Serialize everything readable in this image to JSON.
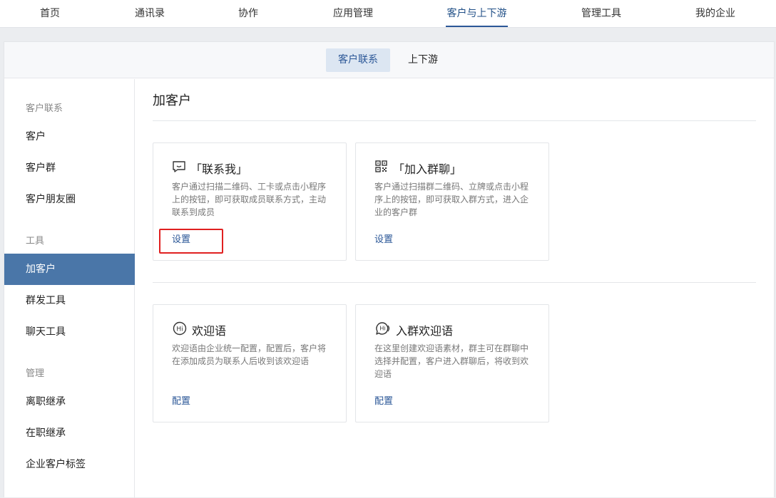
{
  "topnav": {
    "items": [
      "首页",
      "通讯录",
      "协作",
      "应用管理",
      "客户与上下游",
      "管理工具",
      "我的企业"
    ],
    "active_index": 4
  },
  "subtabs": {
    "items": [
      "客户联系",
      "上下游"
    ],
    "active_index": 0
  },
  "sidebar": {
    "group_customer": "客户联系",
    "customer": "客户",
    "customer_group": "客户群",
    "moments": "客户朋友圈",
    "group_tools": "工具",
    "add_customer": "加客户",
    "mass_send": "群发工具",
    "chat_tools": "聊天工具",
    "group_manage": "管理",
    "resign_inherit": "离职继承",
    "onjob_inherit": "在职继承",
    "tags": "企业客户标签"
  },
  "main": {
    "title": "加客户",
    "cards": [
      {
        "title": "「联系我」",
        "desc": "客户通过扫描二维码、工卡或点击小程序上的按钮，即可获取成员联系方式，主动联系到成员",
        "action": "设置",
        "icon": "chat-bubble-icon"
      },
      {
        "title": "「加入群聊」",
        "desc": "客户通过扫描群二维码、立牌或点击小程序上的按钮，即可获取入群方式，进入企业的客户群",
        "action": "设置",
        "icon": "qr-code-icon"
      },
      {
        "title": "欢迎语",
        "desc": "欢迎语由企业统一配置，配置后，客户将在添加成员为联系人后收到该欢迎语",
        "action": "配置",
        "icon": "hi-icon"
      },
      {
        "title": "入群欢迎语",
        "desc": "在这里创建欢迎语素材，群主可在群聊中选择并配置，客户进入群聊后，将收到欢迎语",
        "action": "配置",
        "icon": "hi-bubble-icon"
      }
    ]
  },
  "colors": {
    "accent": "#2b5797",
    "sidebar_active": "#4a76a8",
    "highlight_box": "#e02020"
  }
}
